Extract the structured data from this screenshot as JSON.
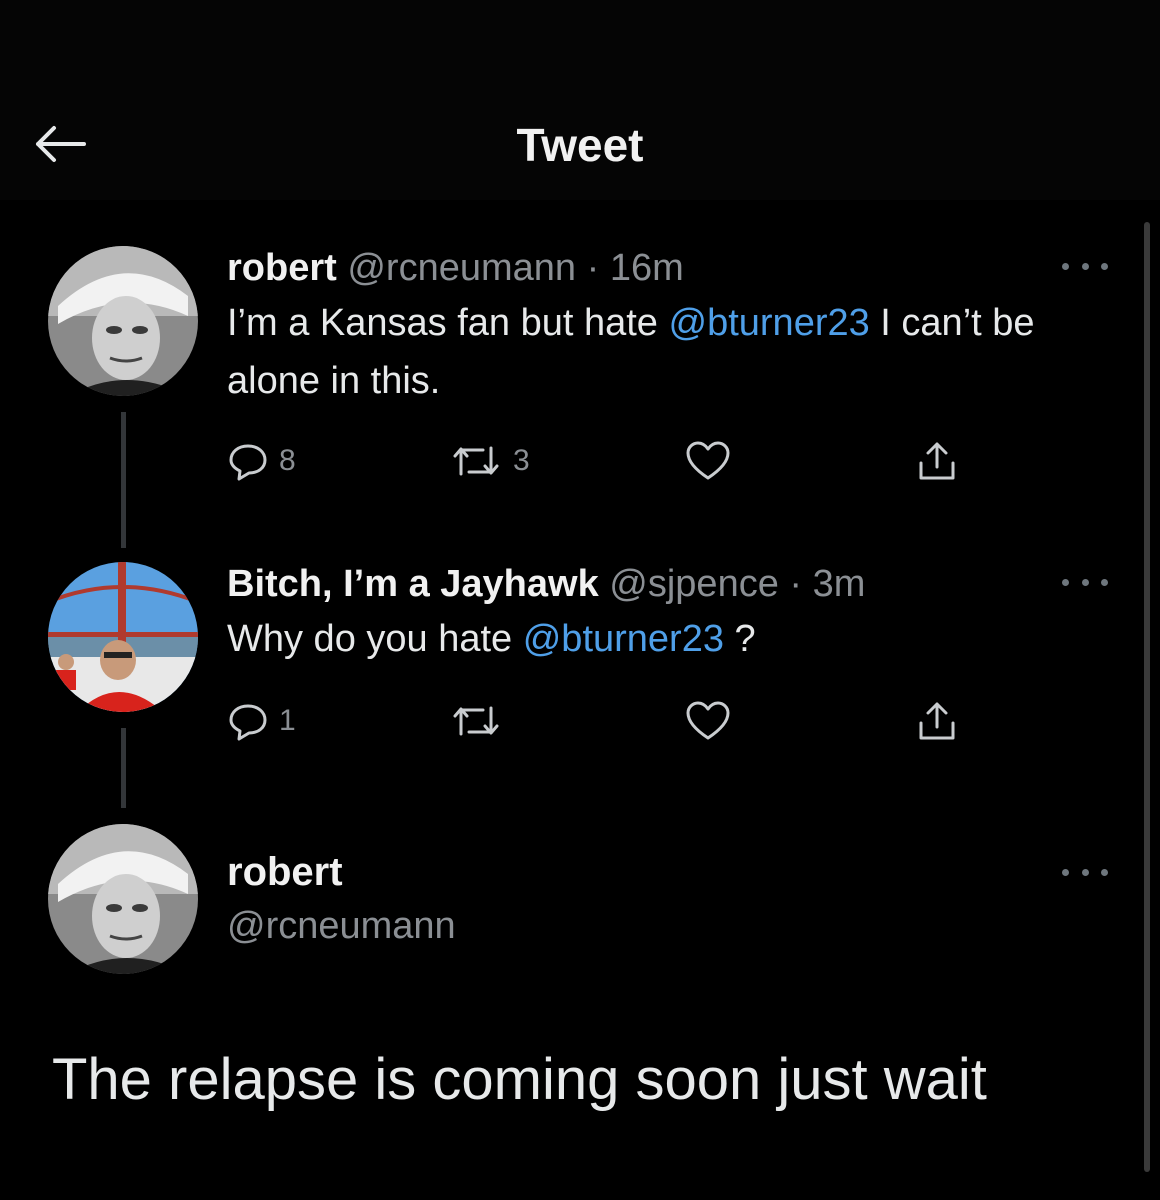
{
  "header": {
    "title": "Tweet",
    "back_icon": "arrow-left-icon"
  },
  "tweets": [
    {
      "name": "robert",
      "handle": "@rcneumann",
      "separator": "·",
      "time": "16m",
      "text_parts": [
        "I’m a Kansas fan but hate ",
        "@bturner23",
        " I can’t be alone in this."
      ],
      "actions": {
        "reply_count": "8",
        "retweet_count": "3",
        "like_count": ""
      }
    },
    {
      "name": "Bitch, I’m a Jayhawk",
      "handle": "@sjpence",
      "separator": "·",
      "time": "3m",
      "text_parts": [
        "Why do you hate ",
        "@bturner23",
        " ?"
      ],
      "actions": {
        "reply_count": "1",
        "retweet_count": "",
        "like_count": ""
      }
    }
  ],
  "main_tweet": {
    "name": "robert",
    "handle": "@rcneumann",
    "text": "The relapse is coming soon just wait"
  },
  "colors": {
    "background": "#000000",
    "mention": "#4f9fe8",
    "muted": "#8b8f94",
    "thread_line": "#333639"
  }
}
